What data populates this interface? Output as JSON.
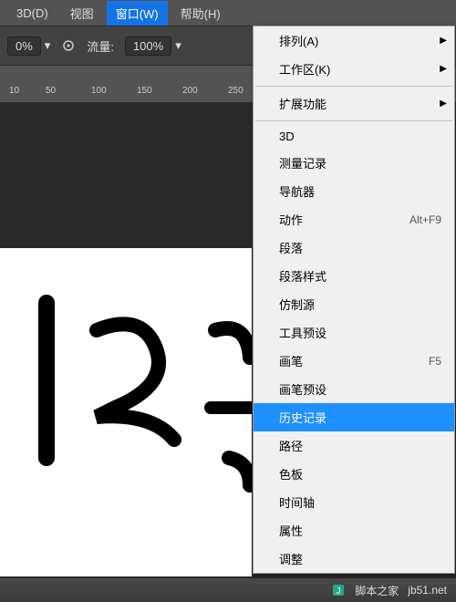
{
  "menubar": {
    "items": [
      {
        "label": "3D(D)"
      },
      {
        "label": "视图"
      },
      {
        "label": "窗口(W)",
        "active": true
      },
      {
        "label": "帮助(H)"
      }
    ]
  },
  "toolbar": {
    "opacity_value": "0%",
    "flow_label": "流量:",
    "flow_value": "100%"
  },
  "ruler": {
    "ticks": [
      "10",
      "50",
      "100",
      "150",
      "200",
      "250"
    ]
  },
  "dropdown": {
    "sections": [
      [
        {
          "label": "排列(A)",
          "submenu": true
        },
        {
          "label": "工作区(K)",
          "submenu": true
        }
      ],
      [
        {
          "label": "扩展功能",
          "submenu": true
        }
      ],
      [
        {
          "label": "3D"
        },
        {
          "label": "测量记录"
        },
        {
          "label": "导航器"
        },
        {
          "label": "动作",
          "shortcut": "Alt+F9"
        },
        {
          "label": "段落"
        },
        {
          "label": "段落样式"
        },
        {
          "label": "仿制源"
        },
        {
          "label": "工具预设"
        },
        {
          "label": "画笔",
          "shortcut": "F5"
        },
        {
          "label": "画笔预设"
        },
        {
          "label": "历史记录",
          "highlighted": true
        },
        {
          "label": "路径"
        },
        {
          "label": "色板"
        },
        {
          "label": "时间轴"
        },
        {
          "label": "属性"
        },
        {
          "label": "调整"
        }
      ]
    ]
  },
  "footer": {
    "site": "脚本之家",
    "url": "jb51.net"
  }
}
